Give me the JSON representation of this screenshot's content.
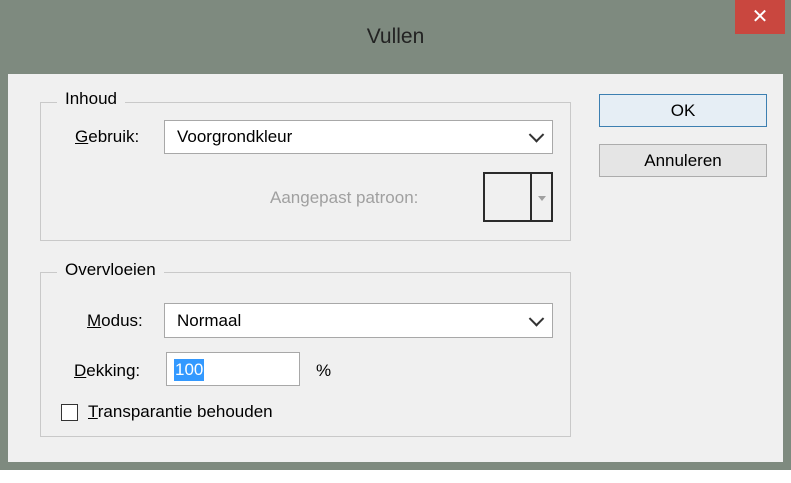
{
  "window": {
    "title": "Vullen",
    "close_glyph": "✕"
  },
  "inhoud": {
    "legend": "Inhoud",
    "gebruik_label_u": "G",
    "gebruik_label_rest": "ebruik:",
    "gebruik_value": "Voorgrondkleur",
    "pattern_label": "Aangepast patroon:"
  },
  "overvloeien": {
    "legend": "Overvloeien",
    "modus_label_u": "M",
    "modus_label_rest": "odus:",
    "modus_value": "Normaal",
    "dekking_label_u": "D",
    "dekking_label_rest": "ekking:",
    "dekking_value": "100",
    "dekking_unit": "%",
    "transparantie_label_u": "T",
    "transparantie_label_rest": "ransparantie behouden",
    "transparantie_checked": false
  },
  "buttons": {
    "ok": "OK",
    "cancel": "Annuleren"
  }
}
